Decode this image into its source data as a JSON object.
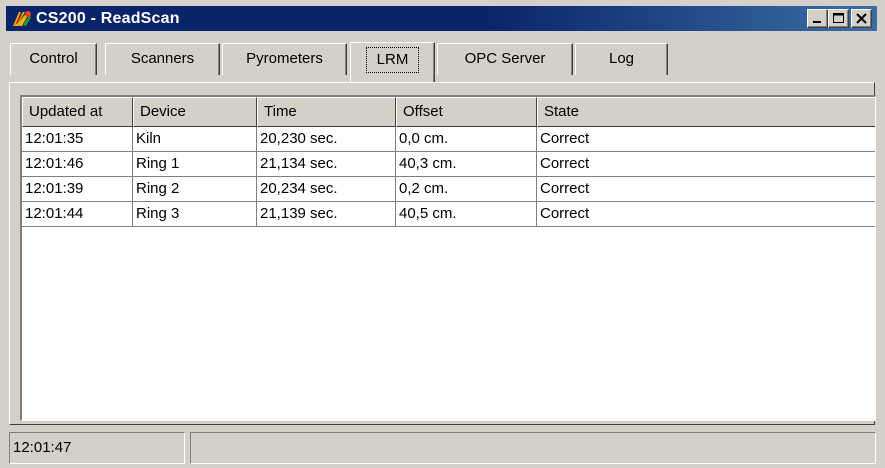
{
  "window": {
    "title": "CS200 - ReadScan",
    "icon": "app-icon",
    "controls": [
      "minimize-icon",
      "maximize-icon",
      "close-icon"
    ]
  },
  "tabs": [
    {
      "label": "Control",
      "active": false
    },
    {
      "label": "Scanners",
      "active": false
    },
    {
      "label": "Pyrometers",
      "active": false
    },
    {
      "label": "LRM",
      "active": true
    },
    {
      "label": "OPC Server",
      "active": false
    },
    {
      "label": "Log",
      "active": false
    }
  ],
  "table": {
    "columns": [
      "Updated at",
      "Device",
      "Time",
      "Offset",
      "State"
    ],
    "rows": [
      [
        "12:01:35",
        "Kiln",
        "20,230 sec.",
        "0,0 cm.",
        "Correct"
      ],
      [
        "12:01:46",
        "Ring 1",
        "21,134 sec.",
        "40,3 cm.",
        "Correct"
      ],
      [
        "12:01:39",
        "Ring 2",
        "20,234 sec.",
        "0,2 cm.",
        "Correct"
      ],
      [
        "12:01:44",
        "Ring 3",
        "21,139 sec.",
        "40,5 cm.",
        "Correct"
      ]
    ]
  },
  "statusbar": {
    "time": "12:01:47",
    "message": ""
  },
  "colors": {
    "titlebar": "#0a246a",
    "face": "#d4d0c8"
  }
}
